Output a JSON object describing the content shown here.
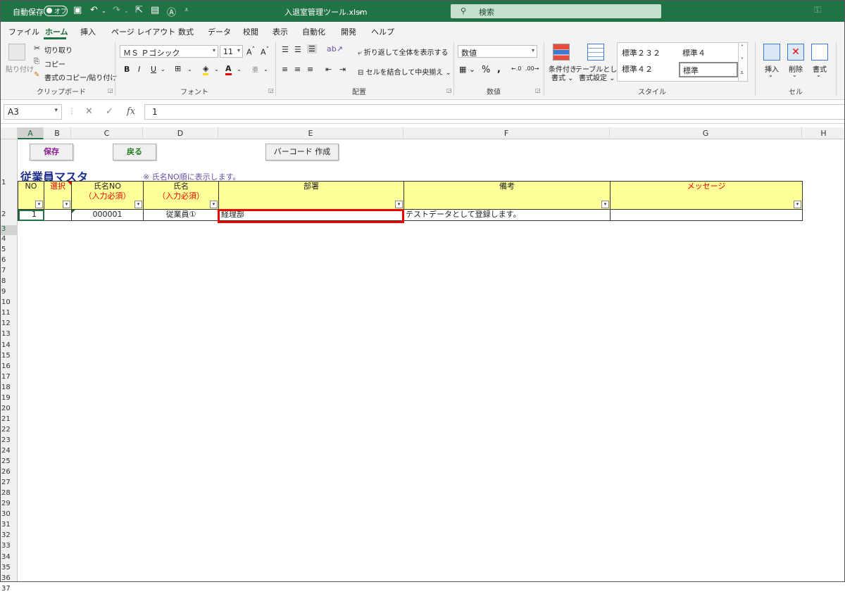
{
  "titlebar": {
    "autosave_label": "自動保存",
    "autosave_state": "オフ",
    "filename": "入退室管理ツール.xlsm",
    "search_placeholder": "検索",
    "bg_color": "#217346"
  },
  "tabs": [
    "ファイル",
    "ホーム",
    "挿入",
    "ページ レイアウト",
    "数式",
    "データ",
    "校閲",
    "表示",
    "自動化",
    "開発",
    "ヘルプ"
  ],
  "active_tab": "ホーム",
  "ribbon": {
    "clipboard": {
      "paste": "貼り付け",
      "cut": "切り取り",
      "copy": "コピー",
      "format_painter": "書式のコピー/貼り付け",
      "title": "クリップボード"
    },
    "font": {
      "name": "ＭＳ Ｐゴシック",
      "size": "11",
      "bold": "B",
      "italic": "I",
      "underline": "U",
      "title": "フォント"
    },
    "alignment": {
      "wrap": "折り返して全体を表示する",
      "merge": "セルを結合して中央揃え",
      "title": "配置"
    },
    "number": {
      "format": "数値",
      "title": "数値"
    },
    "styles": {
      "cond_format": "条件付き",
      "cond_format2": "書式",
      "table_format": "テーブルとして",
      "table_format2": "書式設定",
      "style1": "標準２３２",
      "style2": "標準４",
      "style3": "標準４２",
      "style4": "標準",
      "title": "スタイル"
    },
    "cells": {
      "insert": "挿入",
      "delete": "削除",
      "format": "書式",
      "title": "セル"
    }
  },
  "formula_bar": {
    "name_box": "A3",
    "value": "1"
  },
  "columns": [
    "A",
    "B",
    "C",
    "D",
    "E",
    "F",
    "G",
    "H"
  ],
  "rows": [
    "1",
    "2",
    "3",
    "4",
    "5",
    "6",
    "7",
    "8",
    "9",
    "10",
    "11",
    "12",
    "13",
    "14",
    "15",
    "16",
    "17",
    "18",
    "19",
    "20",
    "21",
    "22",
    "23",
    "24",
    "25",
    "26",
    "27",
    "28",
    "29",
    "30",
    "31",
    "32",
    "33",
    "34",
    "35",
    "36",
    "37"
  ],
  "sheet": {
    "buttons": {
      "save": "保存",
      "back": "戻る",
      "barcode": "バーコード 作成"
    },
    "title": "従業員マスタ",
    "note": "※ 氏名NO順に表示します。",
    "headers": {
      "no": "NO",
      "select": "選択",
      "emp_no": "氏名NO",
      "emp_no_req": "（入力必須）",
      "name": "氏名",
      "name_req": "（入力必須）",
      "dept": "部署",
      "remarks": "備考",
      "message": "メッセージ"
    },
    "row3": {
      "no": "1",
      "select": "",
      "emp_no": "000001",
      "name": "従業員①",
      "dept": "経理部",
      "remarks": "テストデータとして登録します。",
      "message": ""
    },
    "header_fill": "#ffff99",
    "highlight_color": "#e00000"
  }
}
